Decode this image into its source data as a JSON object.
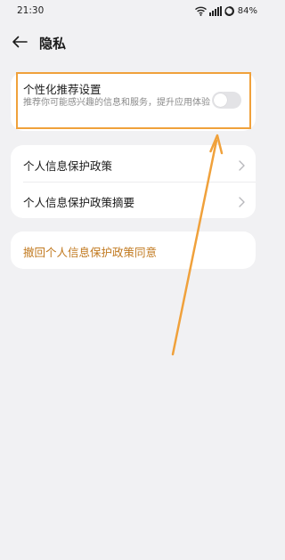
{
  "status_bar": {
    "time": "21:30",
    "battery": "84%",
    "icons": [
      "wifi-icon",
      "signal-icon",
      "battery-icon"
    ]
  },
  "header": {
    "back_icon": "back-arrow-icon",
    "title": "隐私"
  },
  "personalized": {
    "title": "个性化推荐设置",
    "description": "推荐你可能感兴趣的信息和服务，提升应用体验",
    "toggle_on": false
  },
  "policy": {
    "items": [
      {
        "label": "个人信息保护政策",
        "icon": "chevron-right-icon"
      },
      {
        "label": "个人信息保护政策摘要",
        "icon": "chevron-right-icon"
      }
    ]
  },
  "revoke": {
    "label": "撤回个人信息保护政策同意"
  },
  "colors": {
    "background": "#f1f1f3",
    "card": "#ffffff",
    "accent": "#c1791f",
    "annotation": "#f0a13b",
    "toggle_off": "#e3e3e6"
  }
}
